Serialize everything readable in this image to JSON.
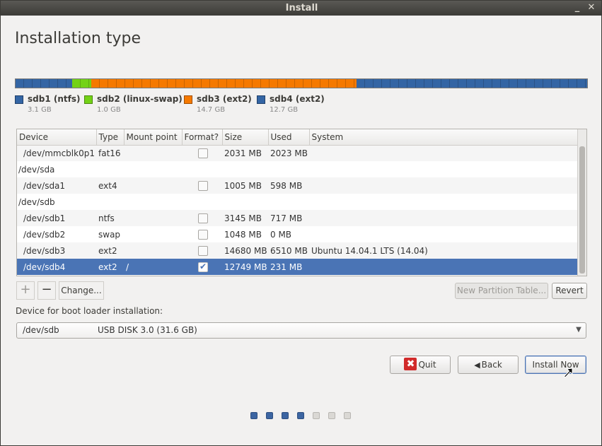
{
  "window": {
    "title": "Install",
    "minimize_glyph": "_",
    "close_glyph": "✕"
  },
  "page": {
    "title": "Installation type"
  },
  "disk": {
    "segments": [
      {
        "name": "sdb1 (ntfs)",
        "size": "3.1 GB",
        "color": "#3465a4",
        "share": 0.099
      },
      {
        "name": "sdb2 (linux-swap)",
        "size": "1.0 GB",
        "color": "#73d216",
        "share": 0.033
      },
      {
        "name": "sdb3 (ext2)",
        "size": "14.7 GB",
        "color": "#f57900",
        "share": 0.464
      },
      {
        "name": "sdb4 (ext2)",
        "size": "12.7 GB",
        "color": "#3465a4",
        "share": 0.404
      }
    ]
  },
  "table": {
    "columns": [
      "Device",
      "Type",
      "Mount point",
      "Format?",
      "Size",
      "Used",
      "System"
    ],
    "rows": [
      {
        "device": "/dev/mmcblk0p1",
        "type": "fat16",
        "mount": "",
        "format": false,
        "has_check": true,
        "size": "2031 MB",
        "used": "2023 MB",
        "system": "",
        "child": true
      },
      {
        "device": "/dev/sda",
        "type": "",
        "mount": "",
        "format": false,
        "has_check": false,
        "size": "",
        "used": "",
        "system": "",
        "child": false
      },
      {
        "device": "/dev/sda1",
        "type": "ext4",
        "mount": "",
        "format": false,
        "has_check": true,
        "size": "1005 MB",
        "used": "598 MB",
        "system": "",
        "child": true
      },
      {
        "device": "/dev/sdb",
        "type": "",
        "mount": "",
        "format": false,
        "has_check": false,
        "size": "",
        "used": "",
        "system": "",
        "child": false
      },
      {
        "device": "/dev/sdb1",
        "type": "ntfs",
        "mount": "",
        "format": false,
        "has_check": true,
        "size": "3145 MB",
        "used": "717 MB",
        "system": "",
        "child": true
      },
      {
        "device": "/dev/sdb2",
        "type": "swap",
        "mount": "",
        "format": false,
        "has_check": true,
        "size": "1048 MB",
        "used": "0 MB",
        "system": "",
        "child": true
      },
      {
        "device": "/dev/sdb3",
        "type": "ext2",
        "mount": "",
        "format": false,
        "has_check": true,
        "size": "14680 MB",
        "used": "6510 MB",
        "system": "Ubuntu 14.04.1 LTS (14.04)",
        "child": true
      },
      {
        "device": "/dev/sdb4",
        "type": "ext2",
        "mount": "/",
        "format": true,
        "has_check": true,
        "size": "12749 MB",
        "used": "231 MB",
        "system": "",
        "child": true,
        "selected": true
      }
    ]
  },
  "toolbar": {
    "add_glyph": "+",
    "remove_glyph": "−",
    "change_label": "Change...",
    "new_table_label": "New Partition Table...",
    "revert_label": "Revert"
  },
  "bootloader": {
    "label": "Device for boot loader installation:",
    "device": "/dev/sdb",
    "description": "USB DISK 3.0 (31.6 GB)"
  },
  "actions": {
    "quit_label": "Quit",
    "back_label": "Back",
    "install_label": "Install Now"
  },
  "progress": {
    "current_step": 4,
    "total_steps": 7
  }
}
